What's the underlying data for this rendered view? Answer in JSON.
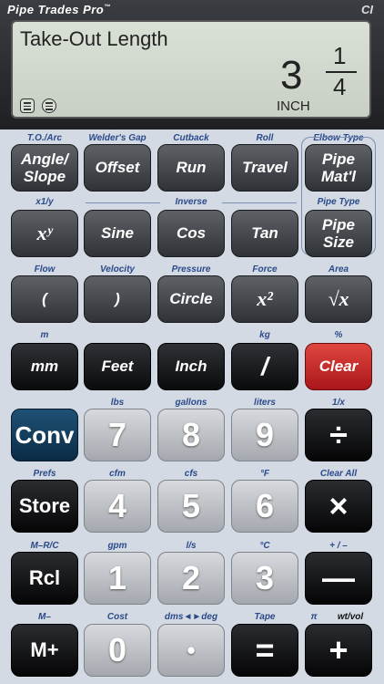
{
  "brand": "Pipe Trades Pro",
  "brand_mark": "™",
  "logo": "CI",
  "display": {
    "title": "Take-Out Length",
    "whole": "3",
    "numerator": "1",
    "denominator": "4",
    "unit": "INCH"
  },
  "labels": {
    "to_arc": "T.O./Arc",
    "welders_gap": "Welder's Gap",
    "cutback": "Cutback",
    "roll": "Roll",
    "elbow_type": "Elbow Type",
    "x1y": "x1/y",
    "inverse": "Inverse",
    "pipe_type": "Pipe Type",
    "flow": "Flow",
    "velocity": "Velocity",
    "pressure": "Pressure",
    "force": "Force",
    "area": "Area",
    "m": "m",
    "kg": "kg",
    "pct": "%",
    "lbs": "lbs",
    "gallons": "gallons",
    "liters": "liters",
    "inv_x": "1/x",
    "prefs": "Prefs",
    "cfm": "cfm",
    "cfs": "cfs",
    "degf": "°F",
    "clear_all": "Clear All",
    "mrc": "M–R/C",
    "gpm": "gpm",
    "ls": "l/s",
    "degc": "°C",
    "plusminus": "+ / –",
    "mminus": "M–",
    "cost": "Cost",
    "dms": "dms◄►deg",
    "tape": "Tape",
    "pi": "π",
    "wtvol": "wt/vol"
  },
  "keys": {
    "angle_slope_1": "Angle/",
    "angle_slope_2": "Slope",
    "offset": "Offset",
    "run": "Run",
    "travel": "Travel",
    "pipe_matl_1": "Pipe",
    "pipe_matl_2": "Mat'l",
    "xy": "xʸ",
    "sine": "Sine",
    "cos": "Cos",
    "tan": "Tan",
    "pipe_size_1": "Pipe",
    "pipe_size_2": "Size",
    "lparen": "(",
    "rparen": ")",
    "circle": "Circle",
    "x2": "x²",
    "sqrt": "√x",
    "mm": "mm",
    "feet": "Feet",
    "inch": "Inch",
    "slash": "/",
    "clear": "Clear",
    "conv": "Conv",
    "seven": "7",
    "eight": "8",
    "nine": "9",
    "divide": "÷",
    "store": "Store",
    "four": "4",
    "five": "5",
    "six": "6",
    "multiply": "×",
    "rcl": "Rcl",
    "one": "1",
    "two": "2",
    "three": "3",
    "minus": "—",
    "mplus": "M+",
    "zero": "0",
    "dot": "•",
    "equals": "=",
    "plus": "+"
  },
  "colors": {
    "label_blue": "#2a4a8a",
    "clear_red": "#c62828",
    "conv_blue": "#123a5c"
  }
}
